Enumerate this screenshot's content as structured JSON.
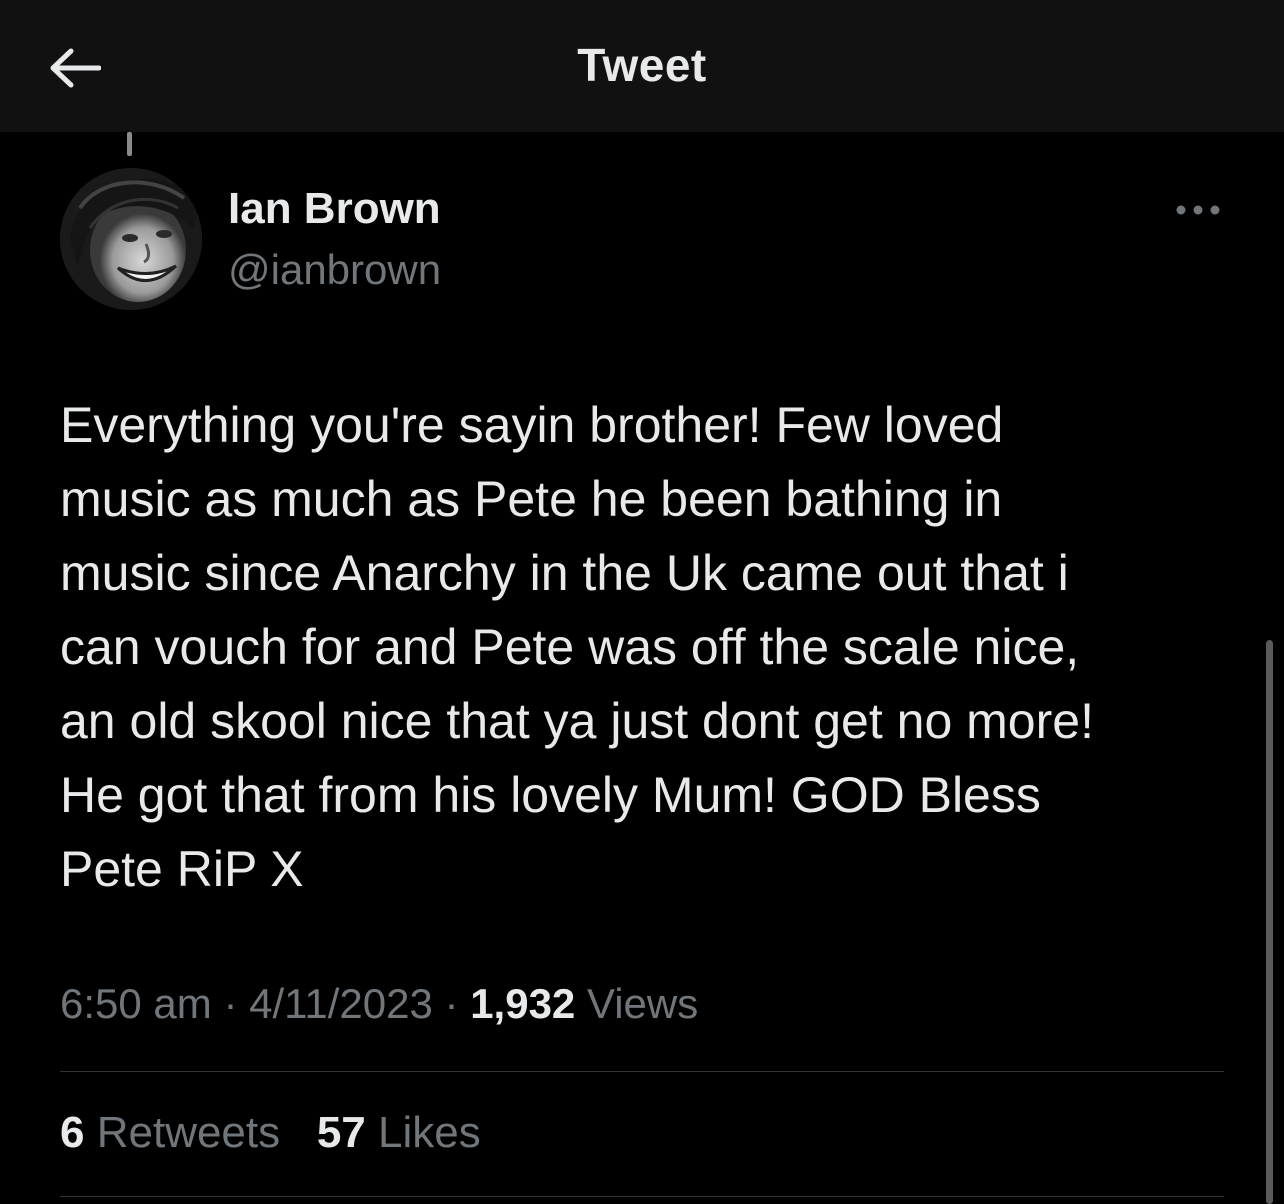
{
  "header": {
    "title": "Tweet",
    "back_icon": "arrow-left-icon"
  },
  "tweet": {
    "author": {
      "display_name": "Ian Brown",
      "handle": "@ianbrown",
      "avatar": "profile-photo"
    },
    "more_icon": "ellipsis-icon",
    "text": "Everything you're sayin brother! Few loved\nmusic as much as Pete he been bathing in\nmusic since Anarchy in the Uk came out that i\ncan vouch for and Pete was off the scale nice,\nan old skool nice that ya just dont get no more!\nHe got that from his lovely Mum! GOD Bless\nPete RiP X",
    "time": "6:50 am",
    "separator": "·",
    "date": "4/11/2023",
    "views_count": "1,932",
    "views_label": "Views",
    "retweets_count": "6",
    "retweets_label": "Retweets",
    "likes_count": "57",
    "likes_label": "Likes"
  },
  "colors": {
    "background": "#000000",
    "header_background": "#111111",
    "primary_text": "#e7e9ea",
    "secondary_text": "#71767b",
    "divider": "#2f3336"
  }
}
